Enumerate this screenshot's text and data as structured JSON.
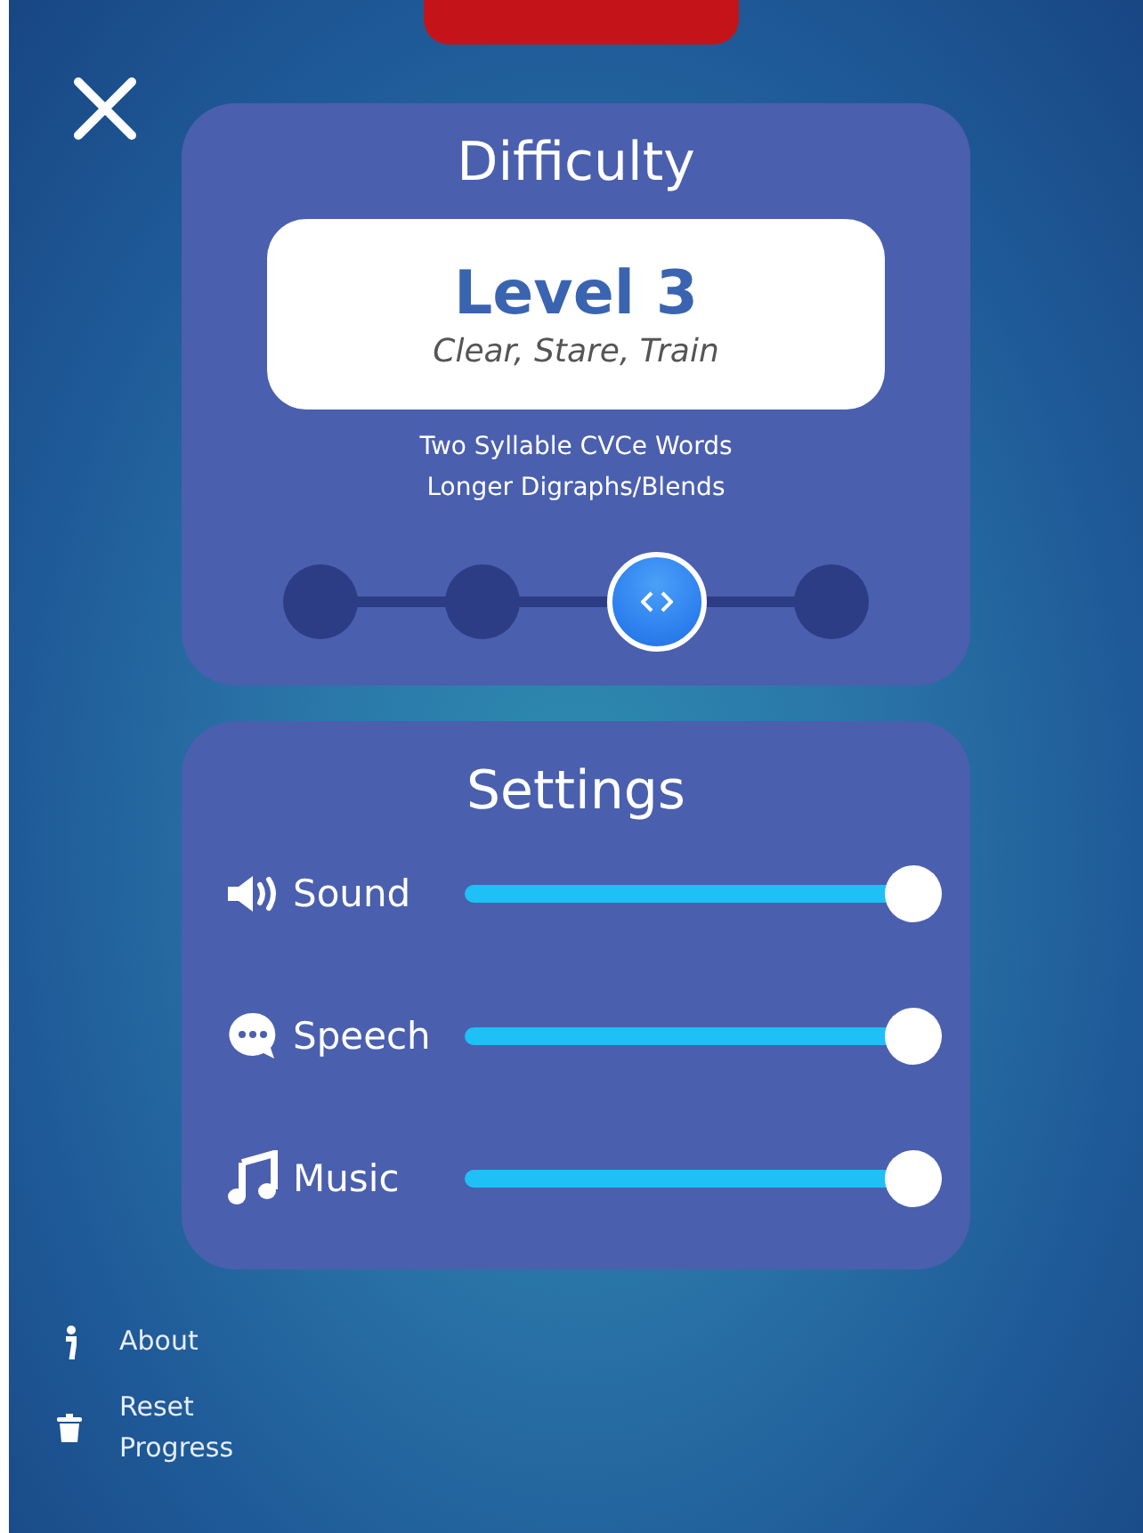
{
  "difficulty": {
    "title": "Difficulty",
    "level_name": "Level 3",
    "examples": "Clear, Stare, Train",
    "description": [
      "Two Syllable CVCe Words",
      "Longer Digraphs/Blends"
    ],
    "stops": [
      {
        "selected": false
      },
      {
        "selected": false
      },
      {
        "selected": true
      },
      {
        "selected": false
      }
    ]
  },
  "settings": {
    "title": "Settings",
    "items": [
      {
        "kind": "sound",
        "label": "Sound",
        "level": 1.0
      },
      {
        "kind": "speech",
        "label": "Speech",
        "level": 1.0
      },
      {
        "kind": "music",
        "label": "Music",
        "level": 1.0
      }
    ]
  },
  "footer": [
    {
      "kind": "info",
      "label": "About"
    },
    {
      "kind": "trash",
      "label": "Reset Progress"
    }
  ]
}
